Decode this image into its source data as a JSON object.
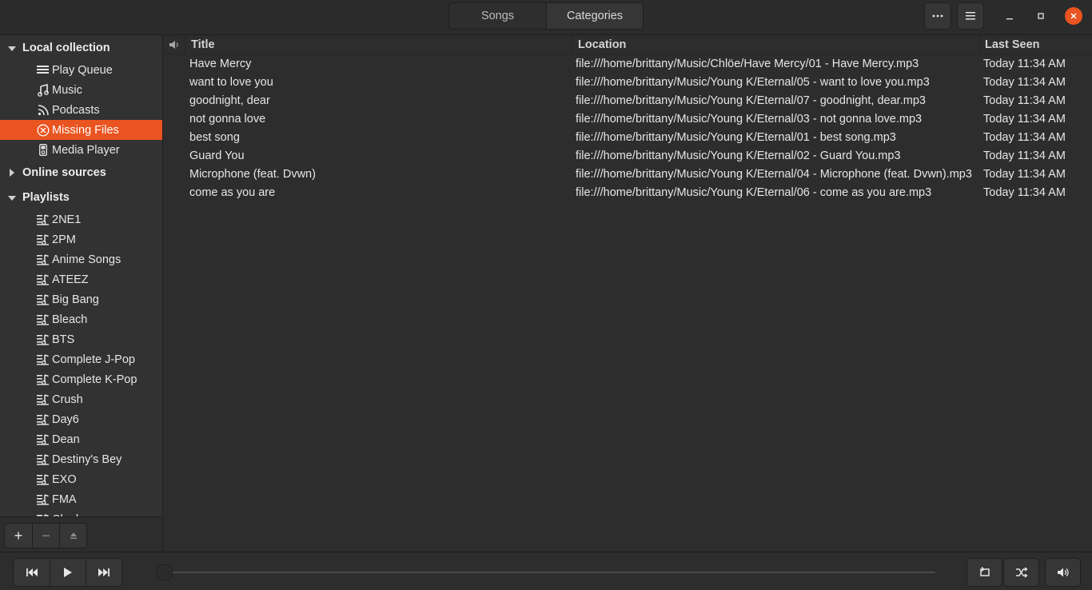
{
  "header": {
    "tabs": [
      {
        "label": "Songs",
        "active": true
      },
      {
        "label": "Categories",
        "active": false
      }
    ],
    "more_icon": "more-horizontal-icon",
    "menu_icon": "hamburger-menu-icon"
  },
  "sidebar": {
    "local_collection": {
      "label": "Local collection",
      "items": [
        {
          "label": "Play Queue",
          "icon": "play-queue-icon"
        },
        {
          "label": "Music",
          "icon": "music-note-icon"
        },
        {
          "label": "Podcasts",
          "icon": "rss-icon"
        },
        {
          "label": "Missing Files",
          "icon": "missing-files-icon",
          "selected": true
        },
        {
          "label": "Media Player",
          "icon": "media-player-icon"
        }
      ]
    },
    "online_sources": {
      "label": "Online sources"
    },
    "playlists": {
      "label": "Playlists",
      "items": [
        {
          "label": "2NE1"
        },
        {
          "label": "2PM"
        },
        {
          "label": "Anime Songs"
        },
        {
          "label": "ATEEZ"
        },
        {
          "label": "Big Bang"
        },
        {
          "label": "Bleach"
        },
        {
          "label": "BTS"
        },
        {
          "label": "Complete J-Pop"
        },
        {
          "label": "Complete K-Pop"
        },
        {
          "label": "Crush"
        },
        {
          "label": "Day6"
        },
        {
          "label": "Dean"
        },
        {
          "label": "Destiny's Bey"
        },
        {
          "label": "EXO"
        },
        {
          "label": "FMA"
        },
        {
          "label": "Cleek"
        }
      ]
    },
    "tools": {
      "add": "+",
      "remove": "−",
      "eject": "⏏"
    }
  },
  "table": {
    "columns": {
      "title": "Title",
      "location": "Location",
      "last_seen": "Last Seen"
    },
    "rows": [
      {
        "title": "Have Mercy",
        "location": "file:///home/brittany/Music/Chlöe/Have Mercy/01 - Have Mercy.mp3",
        "last_seen": "Today 11:34 AM"
      },
      {
        "title": "want to love you",
        "location": "file:///home/brittany/Music/Young K/Eternal/05 - want to love you.mp3",
        "last_seen": "Today 11:34 AM"
      },
      {
        "title": "goodnight, dear",
        "location": "file:///home/brittany/Music/Young K/Eternal/07 - goodnight, dear.mp3",
        "last_seen": "Today 11:34 AM"
      },
      {
        "title": "not gonna love",
        "location": "file:///home/brittany/Music/Young K/Eternal/03 - not gonna love.mp3",
        "last_seen": "Today 11:34 AM"
      },
      {
        "title": "best song",
        "location": "file:///home/brittany/Music/Young K/Eternal/01 - best song.mp3",
        "last_seen": "Today 11:34 AM"
      },
      {
        "title": "Guard You",
        "location": "file:///home/brittany/Music/Young K/Eternal/02 - Guard You.mp3",
        "last_seen": "Today 11:34 AM"
      },
      {
        "title": "Microphone (feat. Dvwn)",
        "location": "file:///home/brittany/Music/Young K/Eternal/04 - Microphone (feat. Dvwn).mp3",
        "last_seen": "Today 11:34 AM"
      },
      {
        "title": "come as you are",
        "location": "file:///home/brittany/Music/Young K/Eternal/06 - come as you are.mp3",
        "last_seen": "Today 11:34 AM"
      }
    ]
  },
  "player": {
    "progress": 0,
    "colors": {
      "accent": "#e95420"
    }
  }
}
